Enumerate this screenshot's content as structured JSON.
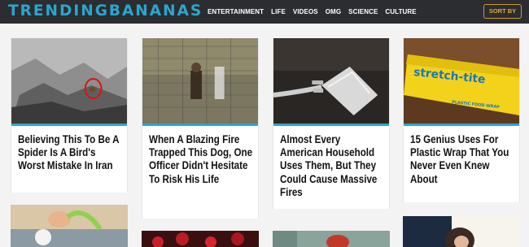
{
  "header": {
    "logo": "TRENDINGBANANAS",
    "nav": [
      "ENTERTAINMENT",
      "LIFE",
      "VIDEOS",
      "OMG",
      "SCIENCE",
      "CULTURE"
    ],
    "sort_label": "SORT BY"
  },
  "cards": [
    {
      "title": "Believing This To Be A Spider Is A Bird's Worst Mistake In Iran"
    },
    {
      "title": "When A Blazing Fire Trapped This Dog, One Officer Didn't Hesitate To Risk His Life"
    },
    {
      "title": "Almost Every American Household Uses Them, But They Could Cause Massive Fires"
    },
    {
      "title": "15 Genius Uses For Plastic Wrap That You Never Even Knew About"
    }
  ],
  "images": {
    "box_label": "stretch-tite",
    "box_sub": "PLASTIC FOOD WRAP"
  },
  "colors": {
    "header_bg": "#2c2d30",
    "accent": "#2aa6cf",
    "sort_border": "#c99a33"
  }
}
